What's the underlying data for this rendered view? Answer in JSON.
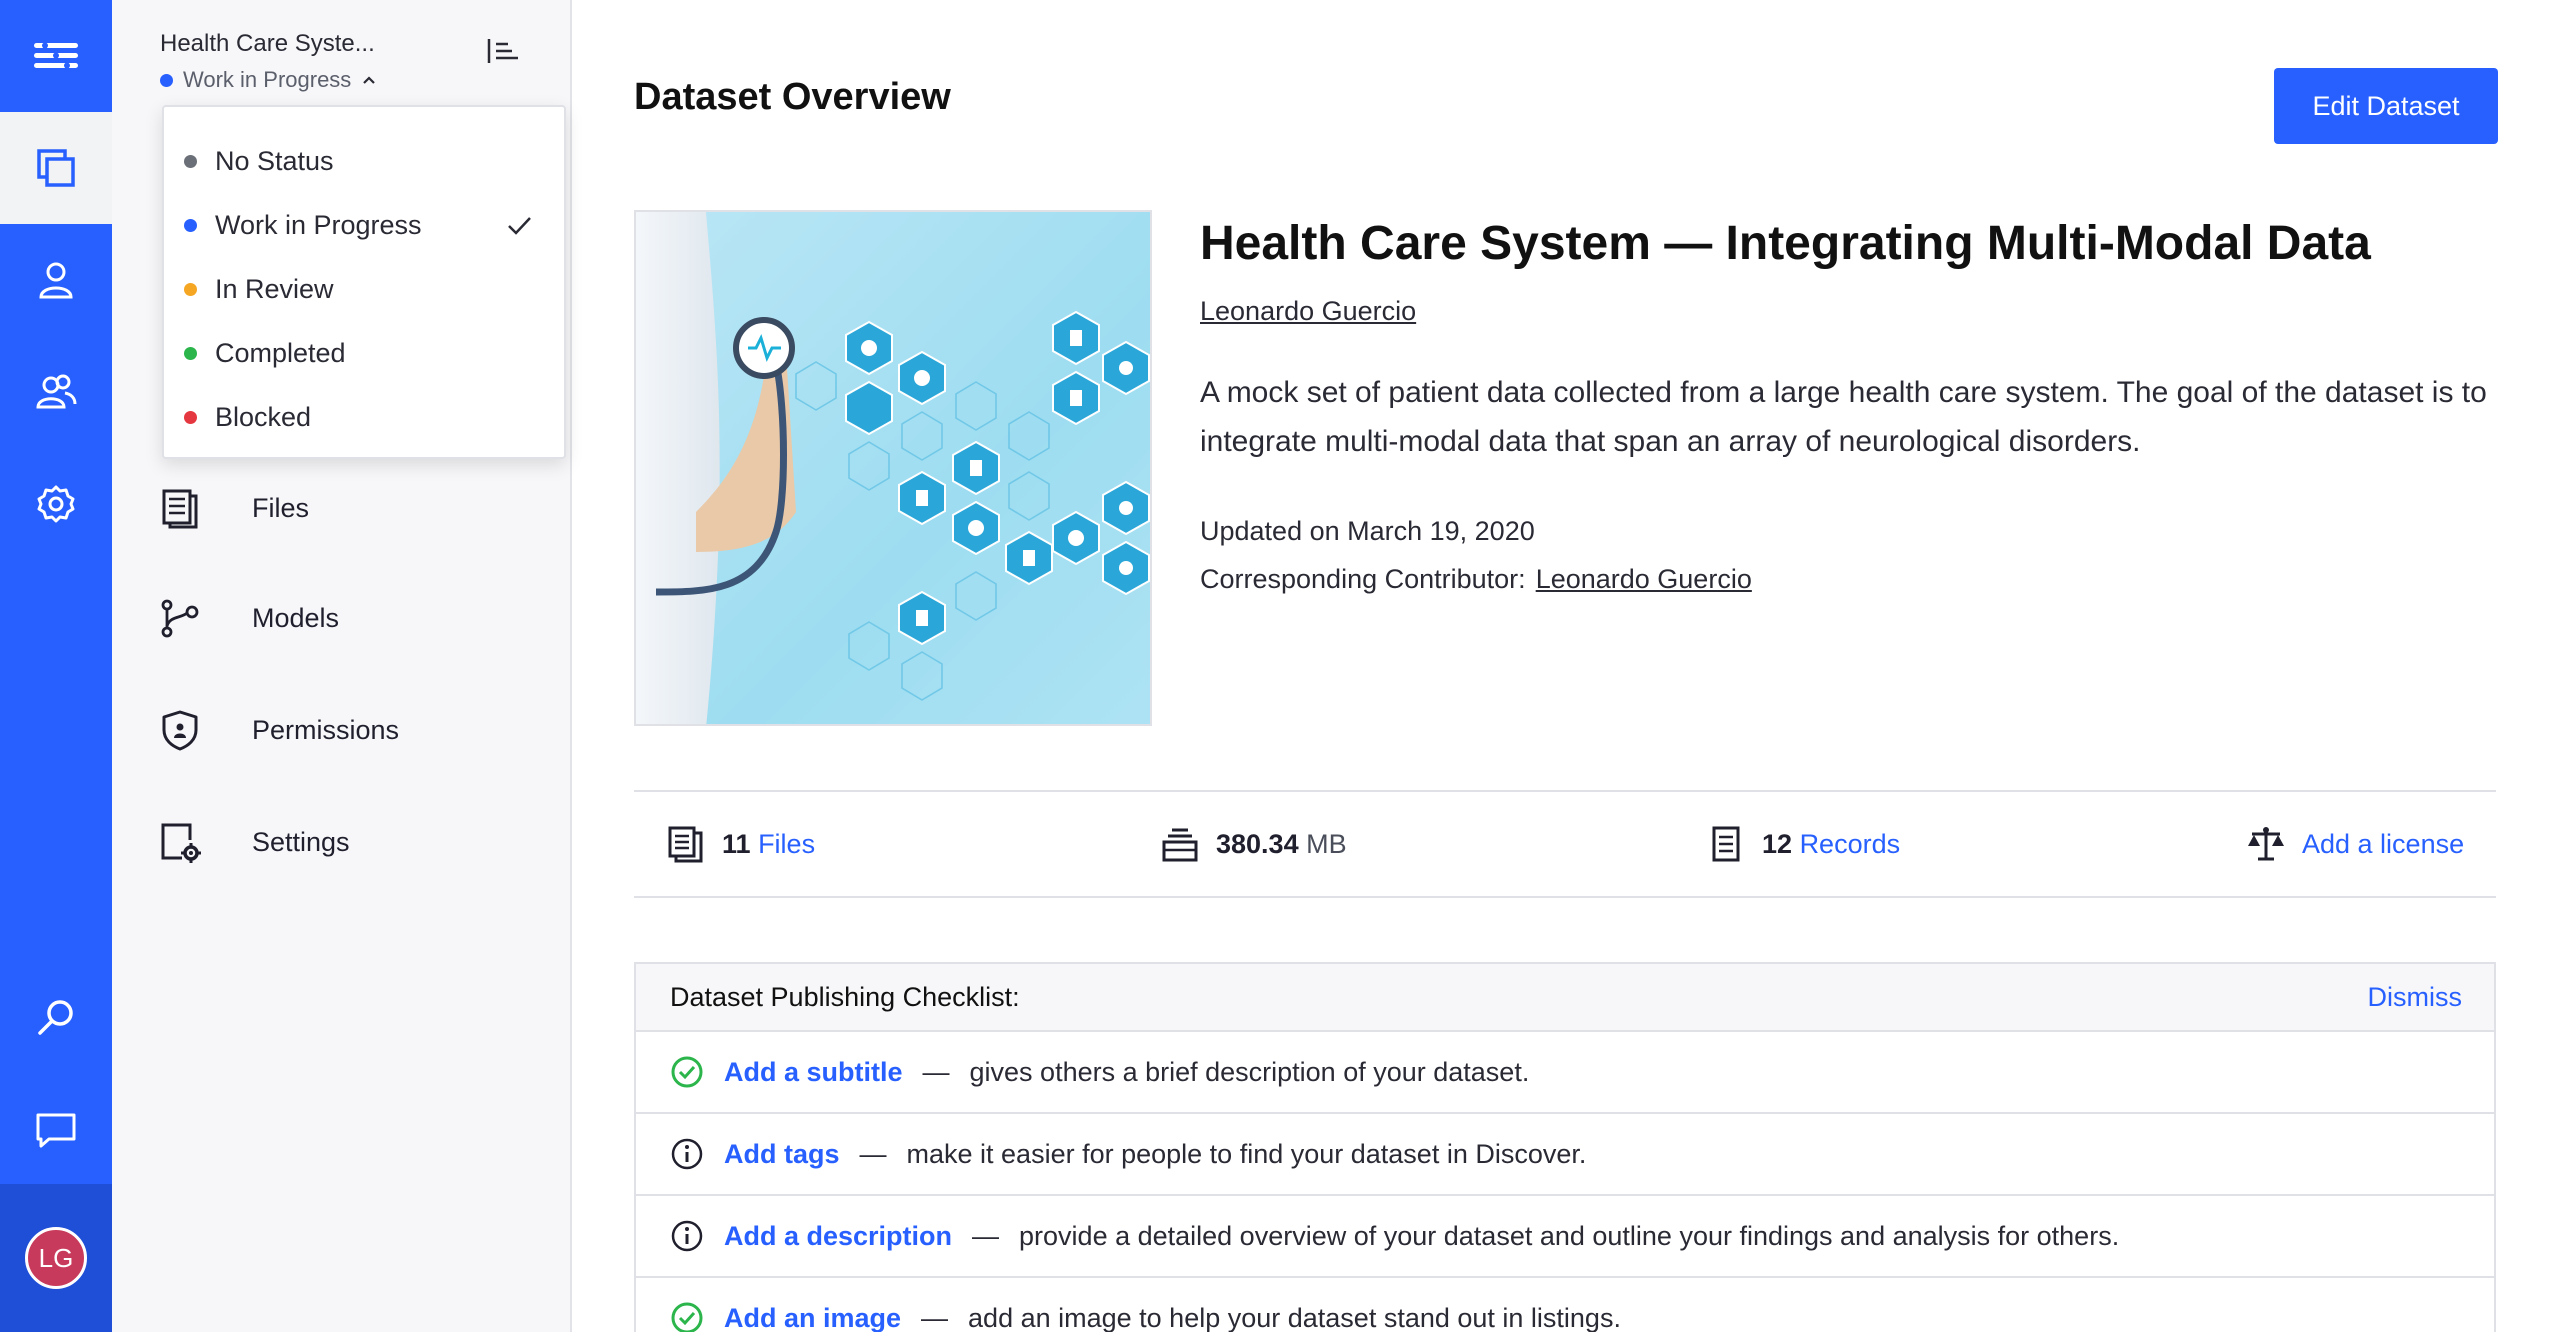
{
  "rail": {
    "avatar_initials": "LG"
  },
  "sidebar": {
    "dataset_title": "Health Care Syste...",
    "status_label": "Work in Progress",
    "items": [
      {
        "label": "Files"
      },
      {
        "label": "Models"
      },
      {
        "label": "Permissions"
      },
      {
        "label": "Settings"
      }
    ]
  },
  "status_dropdown": {
    "options": [
      {
        "label": "No Status",
        "color": "#6b6f78"
      },
      {
        "label": "Work in Progress",
        "color": "#2760ff"
      },
      {
        "label": "In Review",
        "color": "#f5a623"
      },
      {
        "label": "Completed",
        "color": "#2bb54b"
      },
      {
        "label": "Blocked",
        "color": "#e5373f"
      }
    ],
    "selected": "Work in Progress"
  },
  "main": {
    "page_title": "Dataset Overview",
    "edit_button": "Edit Dataset",
    "dataset_name": "Health Care System — Integrating Multi-Modal Data",
    "author": "Leonardo Guercio",
    "description": "A mock set of patient data collected from a large health care system. The goal of the dataset is to integrate multi-modal data that span an array of neurological disorders.",
    "updated": "Updated on March 19, 2020",
    "contributor_label": "Corresponding Contributor:",
    "contributor_name": "Leonardo Guercio"
  },
  "stats": {
    "files_count": "11",
    "files_label": "Files",
    "size_value": "380.34",
    "size_unit": "MB",
    "records_count": "12",
    "records_label": "Records",
    "license_label": "Add a license"
  },
  "checklist": {
    "title": "Dataset Publishing Checklist:",
    "dismiss": "Dismiss",
    "rows": [
      {
        "link": "Add a subtitle",
        "sep": "—",
        "text": "gives others a brief description of your dataset.",
        "status_icon": "check-circle-icon"
      },
      {
        "link": "Add tags",
        "sep": "—",
        "text": "make it easier for people to find your dataset in Discover.",
        "status_icon": "info-circle-icon"
      },
      {
        "link": "Add a description",
        "sep": "—",
        "text": "provide a detailed overview of your dataset and outline your findings and analysis for others.",
        "status_icon": "info-circle-icon"
      },
      {
        "link": "Add an image",
        "sep": "—",
        "text": "add an image to help your dataset stand out in listings.",
        "status_icon": "check-circle-icon"
      }
    ]
  },
  "colors": {
    "brand_blue": "#2760ff",
    "success_green": "#2bb54b"
  }
}
